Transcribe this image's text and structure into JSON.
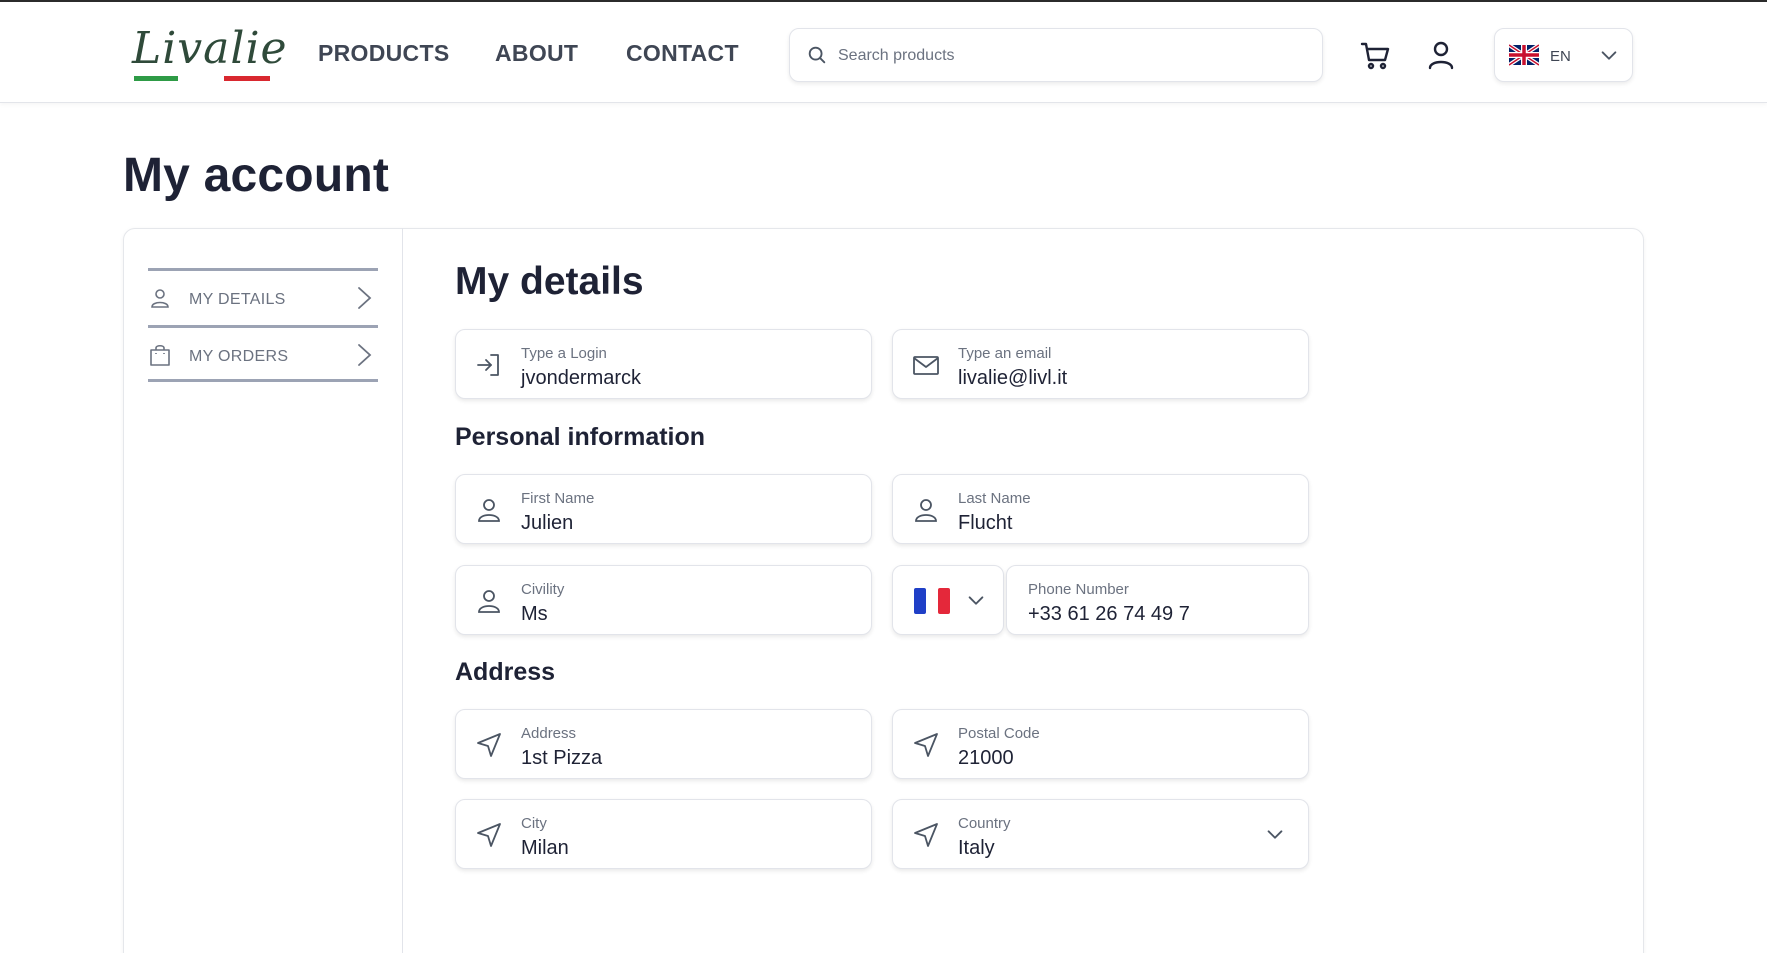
{
  "brand": {
    "logo_text": "Livalie",
    "logo_colors": {
      "green": "#2e9b46",
      "red": "#d9282f"
    }
  },
  "nav": {
    "products": "PRODUCTS",
    "about": "ABOUT",
    "contact": "CONTACT"
  },
  "search": {
    "placeholder": "Search products",
    "value": ""
  },
  "header_icons": {
    "cart": "cart-icon",
    "user": "user-icon"
  },
  "language": {
    "code": "EN",
    "flag": "uk-flag-icon"
  },
  "page": {
    "title": "My account"
  },
  "sidebar": {
    "items": [
      {
        "label": "MY DETAILS",
        "icon": "user-icon"
      },
      {
        "label": "MY ORDERS",
        "icon": "shopping-bag-icon"
      }
    ]
  },
  "details": {
    "title": "My details",
    "login": {
      "label": "Type a Login",
      "value": "jvondermarck",
      "icon": "login-icon"
    },
    "email": {
      "label": "Type an email",
      "value": "livalie@livl.it",
      "icon": "mail-icon"
    },
    "personal_title": "Personal information",
    "first_name": {
      "label": "First Name",
      "value": "Julien",
      "icon": "user-icon"
    },
    "last_name": {
      "label": "Last Name",
      "value": "Flucht",
      "icon": "user-icon"
    },
    "civility": {
      "label": "Civility",
      "value": "Ms",
      "icon": "user-icon"
    },
    "phone": {
      "label": "Phone Number",
      "value": "+33 61 26 74 49 7",
      "country_flag": "france-flag-icon"
    },
    "address_title": "Address",
    "address": {
      "label": "Address",
      "value": "1st Pizza",
      "icon": "navigation-arrow-icon"
    },
    "postal_code": {
      "label": "Postal Code",
      "value": "21000",
      "icon": "navigation-arrow-icon"
    },
    "city": {
      "label": "City",
      "value": "Milan",
      "icon": "navigation-arrow-icon"
    },
    "country": {
      "label": "Country",
      "value": "Italy",
      "icon": "navigation-arrow-icon"
    }
  },
  "colors": {
    "text_dark": "#1e2235",
    "text_muted": "#6b7280",
    "border": "#e2e4ea"
  }
}
